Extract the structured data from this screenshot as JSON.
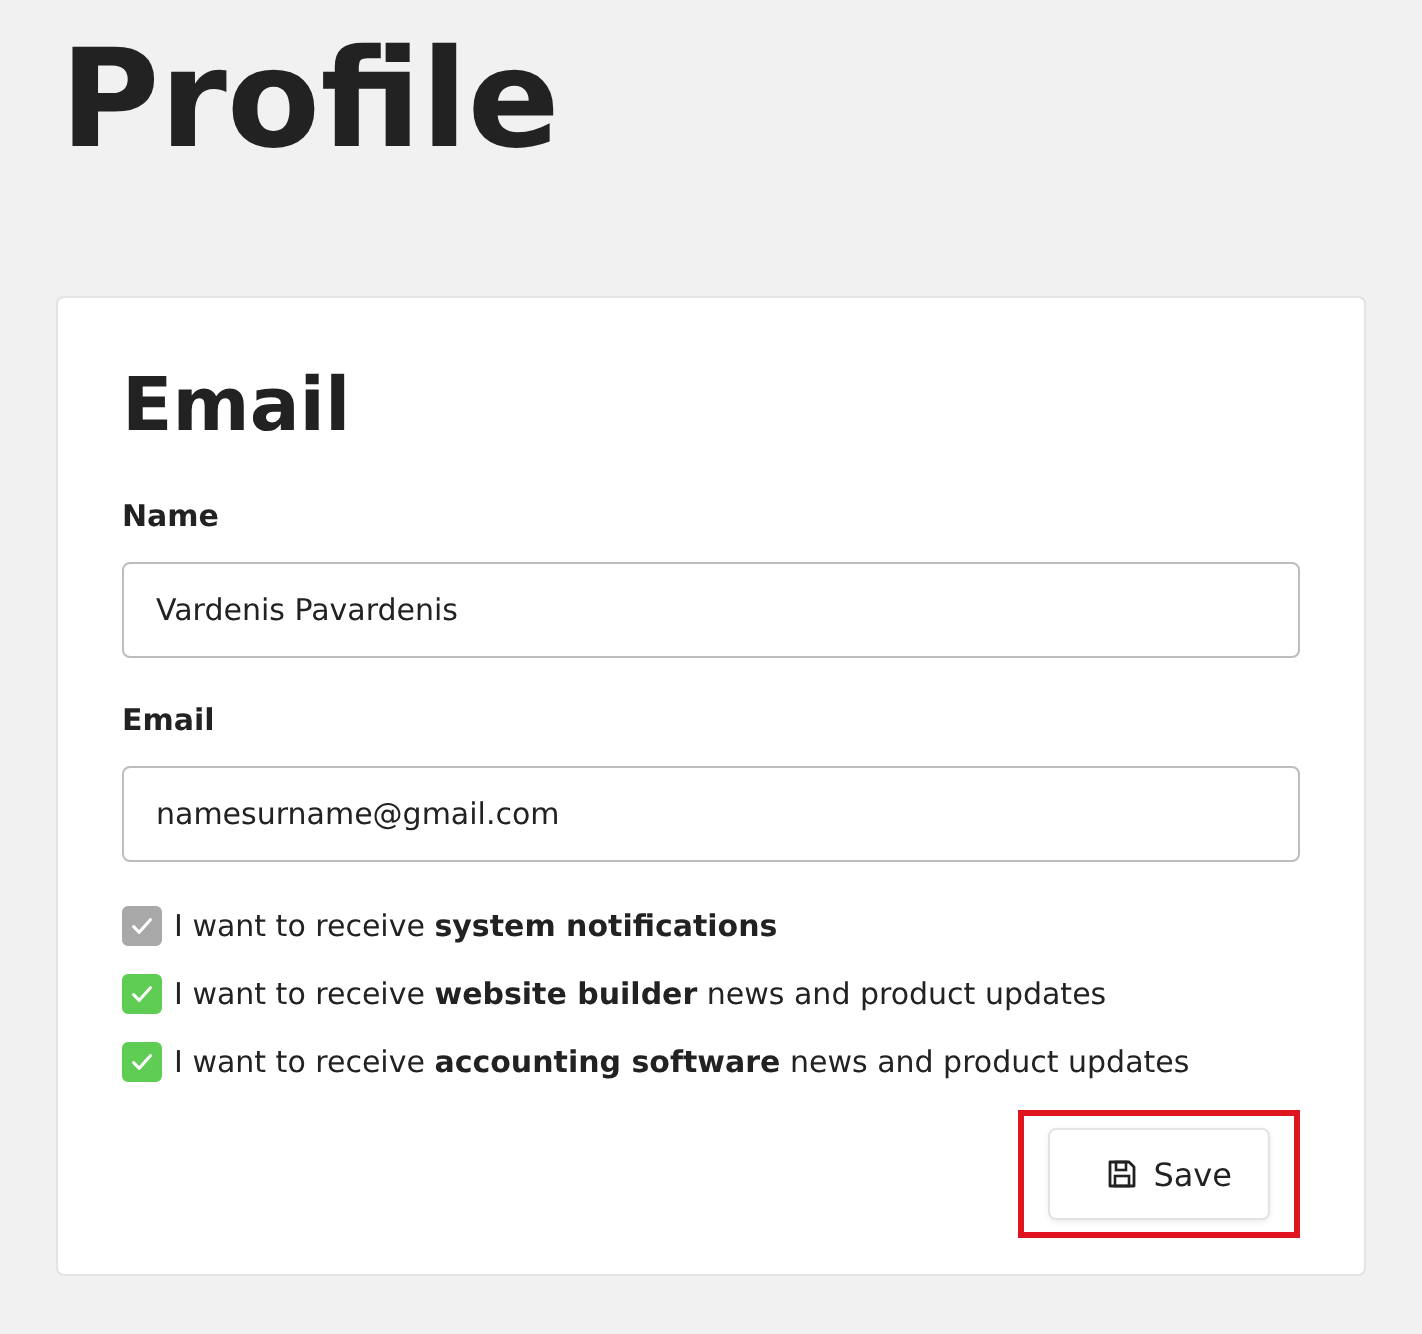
{
  "page": {
    "title": "Profile"
  },
  "card": {
    "title": "Email",
    "fields": [
      {
        "label": "Name",
        "value": "Vardenis Pavardenis"
      },
      {
        "label": "Email",
        "value": "namesurname@gmail.com"
      }
    ],
    "checkboxes": [
      {
        "label": "I want to receive **system notifications**",
        "checked": true,
        "disabled": true
      },
      {
        "label": "I want to receive **website builder** news and product updates",
        "checked": true,
        "disabled": false
      },
      {
        "label": "I want to receive **accounting software** news and product updates",
        "checked": true,
        "disabled": false
      }
    ],
    "save_button": {
      "label": "Save",
      "highlighted": true
    }
  }
}
